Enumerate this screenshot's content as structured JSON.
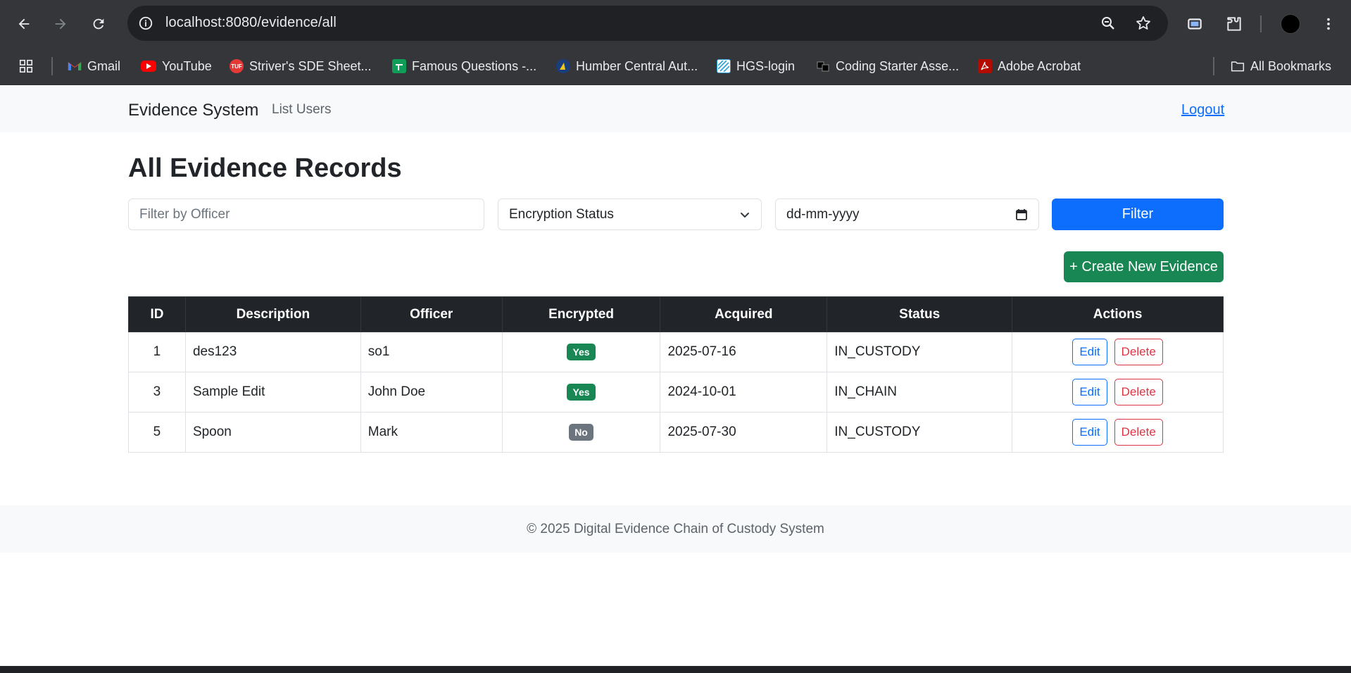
{
  "browser": {
    "url": "localhost:8080/evidence/all",
    "bookmarks": [
      {
        "label": "Gmail",
        "icon": "gmail-icon"
      },
      {
        "label": "YouTube",
        "icon": "youtube-icon"
      },
      {
        "label": "Striver's SDE Sheet...",
        "icon": "tuf-icon"
      },
      {
        "label": "Famous Questions -...",
        "icon": "sheets-icon"
      },
      {
        "label": "Humber Central Aut...",
        "icon": "humber-icon"
      },
      {
        "label": "HGS-login",
        "icon": "hgs-icon"
      },
      {
        "label": "Coding Starter Asse...",
        "icon": "coding-icon"
      },
      {
        "label": "Adobe Acrobat",
        "icon": "acrobat-icon"
      }
    ],
    "all_bookmarks_label": "All Bookmarks"
  },
  "navbar": {
    "brand": "Evidence System",
    "list_users": "List Users",
    "logout": "Logout"
  },
  "page": {
    "title": "All Evidence Records"
  },
  "filters": {
    "officer_placeholder": "Filter by Officer",
    "encryption_status": "Encryption Status",
    "date_placeholder": "dd-mm-yyyy",
    "filter_button": "Filter"
  },
  "create_button": "+ Create New Evidence",
  "table": {
    "headers": [
      "ID",
      "Description",
      "Officer",
      "Encrypted",
      "Acquired",
      "Status",
      "Actions"
    ],
    "rows": [
      {
        "id": "1",
        "description": "des123",
        "officer": "so1",
        "encrypted": "Yes",
        "acquired": "2025-07-16",
        "status": "IN_CUSTODY"
      },
      {
        "id": "3",
        "description": "Sample Edit",
        "officer": "John Doe",
        "encrypted": "Yes",
        "acquired": "2024-10-01",
        "status": "IN_CHAIN"
      },
      {
        "id": "5",
        "description": "Spoon",
        "officer": "Mark",
        "encrypted": "No",
        "acquired": "2025-07-30",
        "status": "IN_CUSTODY"
      }
    ],
    "edit_label": "Edit",
    "delete_label": "Delete"
  },
  "footer": "© 2025 Digital Evidence Chain of Custody System",
  "colors": {
    "primary": "#0d6efd",
    "success": "#198754",
    "danger": "#dc3545",
    "secondary": "#6c757d",
    "dark": "#212529"
  }
}
